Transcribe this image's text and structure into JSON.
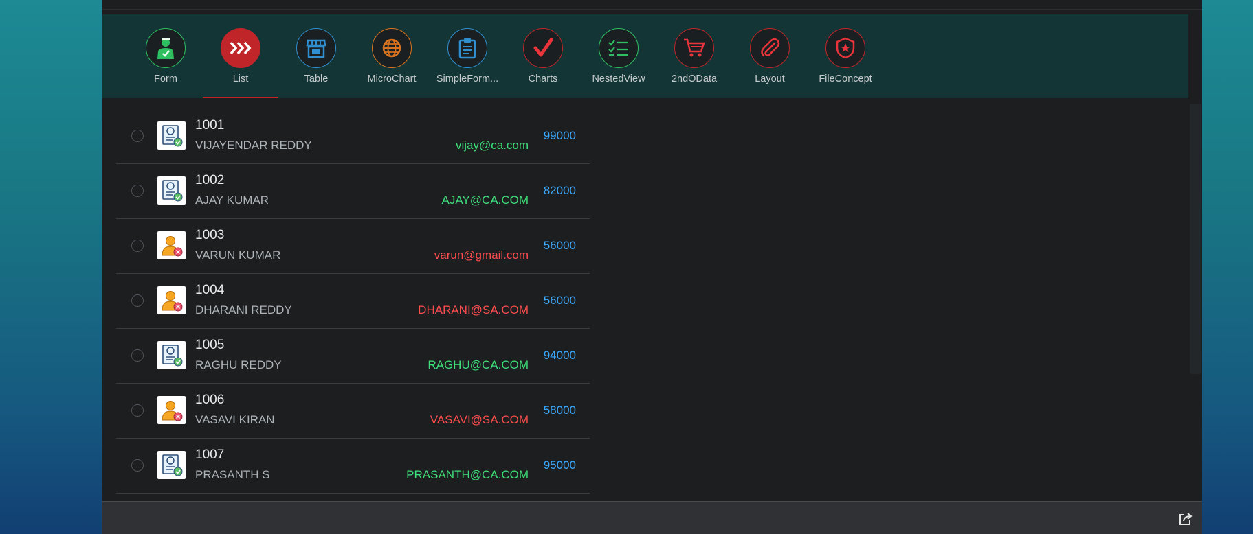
{
  "nav": {
    "tabs": [
      {
        "label": "Form",
        "icon": "user-check-icon",
        "ring": "#2fbe60"
      },
      {
        "label": "List",
        "icon": "chevrons-right-icon",
        "ring": "#c0252a"
      },
      {
        "label": "Table",
        "icon": "store-icon",
        "ring": "#2f8fd0"
      },
      {
        "label": "MicroChart",
        "icon": "globe-icon",
        "ring": "#d9731f"
      },
      {
        "label": "SimpleForm...",
        "icon": "clipboard-icon",
        "ring": "#2f8fd0"
      },
      {
        "label": "Charts",
        "icon": "checkmark-icon",
        "ring": "#c0252a"
      },
      {
        "label": "NestedView",
        "icon": "checklist-icon",
        "ring": "#2fbe60"
      },
      {
        "label": "2ndOData",
        "icon": "cart-icon",
        "ring": "#c0252a"
      },
      {
        "label": "Layout",
        "icon": "paperclip-icon",
        "ring": "#c0252a"
      },
      {
        "label": "FileConcept",
        "icon": "badge-icon",
        "ring": "#c0252a"
      }
    ],
    "active_tab": "List"
  },
  "list": {
    "items": [
      {
        "id": "1001",
        "name": "VIJAYENDAR REDDY",
        "email": "vijay@ca.com",
        "email_status": "valid",
        "amount": "99000",
        "avatar": "certificate-icon"
      },
      {
        "id": "1002",
        "name": "AJAY KUMAR",
        "email": "AJAY@CA.COM",
        "email_status": "valid",
        "amount": "82000",
        "avatar": "certificate-icon"
      },
      {
        "id": "1003",
        "name": "VARUN KUMAR",
        "email": "varun@gmail.com",
        "email_status": "invalid",
        "amount": "56000",
        "avatar": "person-icon"
      },
      {
        "id": "1004",
        "name": "DHARANI REDDY",
        "email": "DHARANI@SA.COM",
        "email_status": "invalid",
        "amount": "56000",
        "avatar": "person-icon"
      },
      {
        "id": "1005",
        "name": "RAGHU REDDY",
        "email": "RAGHU@CA.COM",
        "email_status": "valid",
        "amount": "94000",
        "avatar": "certificate-icon"
      },
      {
        "id": "1006",
        "name": "VASAVI KIRAN",
        "email": "VASAVI@SA.COM",
        "email_status": "invalid",
        "amount": "58000",
        "avatar": "person-icon"
      },
      {
        "id": "1007",
        "name": "PRASANTH S",
        "email": "PRASANTH@CA.COM",
        "email_status": "valid",
        "amount": "95000",
        "avatar": "certificate-icon"
      }
    ]
  },
  "footer": {
    "action_icon": "share-icon"
  },
  "colors": {
    "valid": "#3fe07a",
    "invalid": "#ff4d4d",
    "amount": "#3aa9ff",
    "accent": "#c0252a"
  }
}
